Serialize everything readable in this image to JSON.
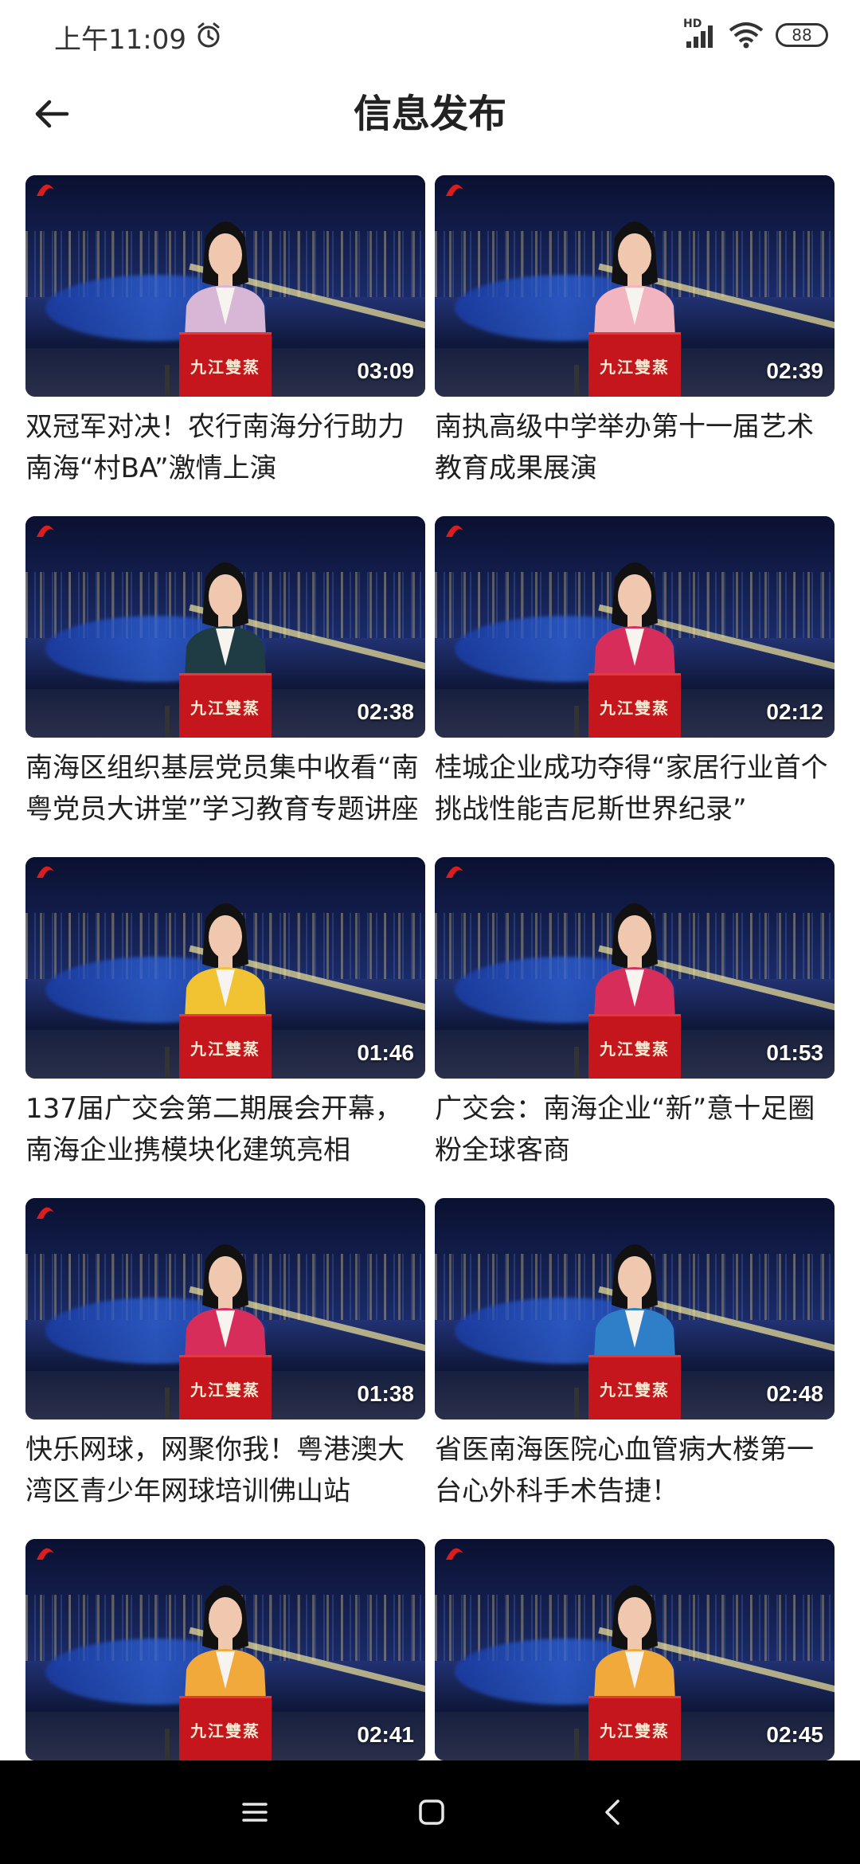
{
  "status_bar": {
    "time": "上午11:09",
    "hd_label": "HD",
    "battery": "88",
    "icons": [
      "alarm-icon",
      "signal-icon",
      "wifi-icon",
      "battery-icon"
    ]
  },
  "header": {
    "title": "信息发布",
    "back_icon": "arrow-left-icon"
  },
  "videos": [
    {
      "title": "双冠军对决！农行南海分行助力南海“村BA”激情上演",
      "duration": "03:09",
      "outfit": "#d8b6d6"
    },
    {
      "title": "南执高级中学举办第十一届艺术教育成果展演",
      "duration": "02:39",
      "outfit": "#f2b4be"
    },
    {
      "title": "南海区组织基层党员集中收看“南粤党员大讲堂”学习教育专题讲座",
      "duration": "02:38",
      "outfit": "#1f3c44"
    },
    {
      "title": "桂城企业成功夺得“家居行业首个挑战性能吉尼斯世界纪录”",
      "duration": "02:12",
      "outfit": "#d72d5b"
    },
    {
      "title": "137届广交会第二期展会开幕，南海企业携模块化建筑亮相",
      "duration": "01:46",
      "outfit": "#f1c232"
    },
    {
      "title": "广交会：南海企业“新”意十足圈粉全球客商",
      "duration": "01:53",
      "outfit": "#d72d5b"
    },
    {
      "title": "快乐网球，网聚你我！粤港澳大湾区青少年网球培训佛山站",
      "duration": "01:38",
      "outfit": "#d72d5b"
    },
    {
      "title": "省医南海医院心血管病大楼第一台心外科手术告捷！",
      "duration": "02:48",
      "outfit": "#2f7fc8"
    },
    {
      "title": "",
      "duration": "02:41",
      "outfit": "#f2a93b"
    },
    {
      "title": "",
      "duration": "02:45",
      "outfit": "#f2a93b"
    }
  ],
  "podium_text": "九江雙蒸",
  "nav_bar": {
    "icons": [
      "menu-icon",
      "home-square-icon",
      "back-chevron-icon"
    ]
  }
}
